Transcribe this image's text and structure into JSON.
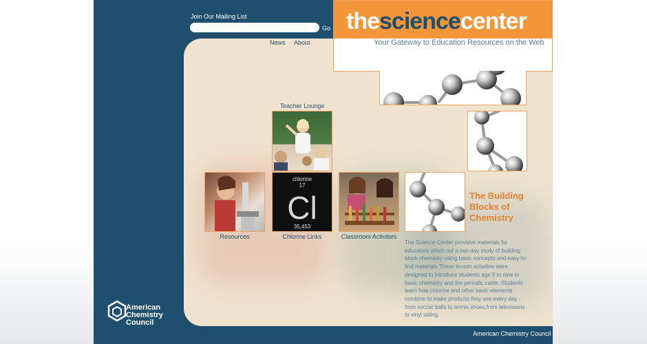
{
  "mailing": {
    "label": "Join Our Mailing List",
    "value": "",
    "go": "Go"
  },
  "nav": [
    {
      "label": "News"
    },
    {
      "label": "About"
    }
  ],
  "logo": {
    "the": "the",
    "science": "science",
    "center": "center",
    "tagline": "Your Gateway to Education Resources on the Web"
  },
  "tiles": {
    "teacher": "Teacher Lounge",
    "resources": "Resources",
    "chlorine": "Chlorine Links",
    "classroom": "Classroom Activities"
  },
  "element": {
    "name": "chlorine",
    "number": "17",
    "symbol": "Cl",
    "mass": "35,453"
  },
  "blocks": {
    "title": "The Building Blocks of Chemistry",
    "text": "The Science Center provides materials for educators which out a two-day study of building block chemistry using basic concepts and easy-to-find materials.These lesson activities were designed to introduce students age 8 to nine to basic chemistry and the periodic cable. Students learn how chlorine and other basic elements combine to make products they use every day - from soccer balls to tennis shoes,from televisions to vinyl siding."
  },
  "acc": {
    "line1": "American",
    "line2": "Chemistry",
    "line3": "Council"
  },
  "footer": "American Chemistry Council",
  "colors": {
    "frame": "#1f4f6e",
    "accent": "#f3963a",
    "panel": "#efe3cf"
  }
}
